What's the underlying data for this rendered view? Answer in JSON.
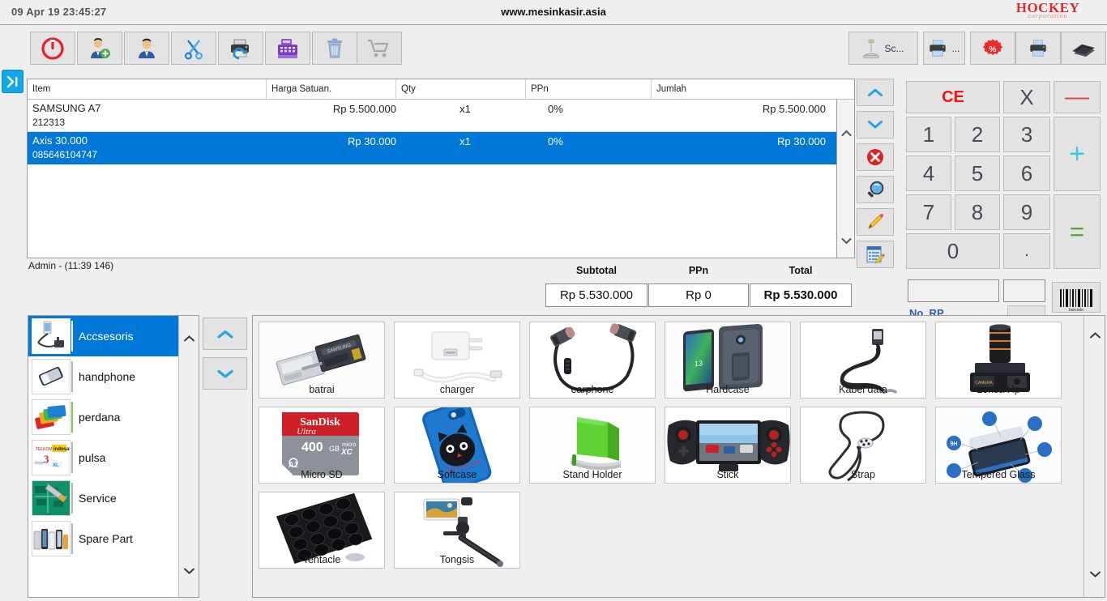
{
  "titlebar": {
    "datetime": "09 Apr 19  23:45:27",
    "site": "www.mesinkasir.asia",
    "logo_brand": "HOCKEY",
    "logo_sub": "corporation"
  },
  "toolbar_left": [
    {
      "name": "power-button",
      "icon": "power-icon",
      "label": ""
    },
    {
      "name": "add-customer-button",
      "icon": "user-add-icon",
      "label": ""
    },
    {
      "name": "customer-button",
      "icon": "user-icon",
      "label": ""
    },
    {
      "name": "cut-button",
      "icon": "scissors-icon",
      "label": ""
    },
    {
      "name": "reprint-button",
      "icon": "printer-refresh-icon",
      "label": ""
    },
    {
      "name": "cash-register-button",
      "icon": "cash-register-icon",
      "label": ""
    },
    {
      "name": "delete-button",
      "icon": "trash-icon",
      "label": ""
    },
    {
      "name": "cart-button",
      "icon": "cart-icon",
      "label": ""
    }
  ],
  "toolbar_right": [
    {
      "name": "scale-button",
      "icon": "scale-icon",
      "label": "Sc..."
    },
    {
      "name": "print-options-button",
      "icon": "printer-icon",
      "label": "..."
    },
    {
      "name": "discount-button",
      "icon": "discount-percent-icon",
      "label": ""
    },
    {
      "name": "print-button",
      "icon": "printer-icon",
      "label": ""
    },
    {
      "name": "card-button",
      "icon": "card-stack-icon",
      "label": ""
    }
  ],
  "cart": {
    "headers": [
      "Item",
      "Harga Satuan.",
      "Qty",
      "PPn",
      "Jumlah"
    ],
    "rows": [
      {
        "name": "SAMSUNG A7",
        "code": "212313",
        "price": "Rp 5.500.000",
        "qty": "x1",
        "ppn": "0%",
        "sum": "Rp 5.500.000",
        "selected": false
      },
      {
        "name": "Axis 30.000",
        "code": "085646104747",
        "price": "Rp 30.000",
        "qty": "x1",
        "ppn": "0%",
        "sum": "Rp 30.000",
        "selected": true
      }
    ]
  },
  "side_actions": [
    {
      "name": "move-up-button",
      "icon": "chevron-up-icon"
    },
    {
      "name": "move-down-button",
      "icon": "chevron-down-icon"
    },
    {
      "name": "remove-item-button",
      "icon": "delete-circle-icon"
    },
    {
      "name": "search-item-button",
      "icon": "magnifier-icon"
    },
    {
      "name": "edit-item-button",
      "icon": "pencil-icon"
    },
    {
      "name": "note-button",
      "icon": "notes-edit-icon"
    }
  ],
  "summary": {
    "status_user": "Admin - (11:39 146)",
    "subtotal_label": "Subtotal",
    "ppn_label": "PPn",
    "total_label": "Total",
    "subtotal_value": "Rp 5.530.000",
    "ppn_value": "Rp 0",
    "total_value": "Rp 5.530.000"
  },
  "numpad": {
    "ce": "CE",
    "x": "X",
    "minus": "—",
    "plus": "+",
    "equals": "=",
    "dot": ".",
    "digits": [
      "1",
      "2",
      "3",
      "4",
      "5",
      "6",
      "7",
      "8",
      "9",
      "0"
    ]
  },
  "payment": {
    "amount_value": "",
    "small_value": "",
    "barcode_icon": "barcode-icon",
    "clipped_label": "No. RP"
  },
  "categories": {
    "items": [
      {
        "label": "Accsesoris",
        "selected": true,
        "thumb": "accessory-mount"
      },
      {
        "label": "handphone",
        "selected": false,
        "thumb": "phone"
      },
      {
        "label": "perdana",
        "selected": false,
        "thumb": "sim-cards"
      },
      {
        "label": "pulsa",
        "selected": false,
        "thumb": "credit-logos"
      },
      {
        "label": "Service",
        "selected": false,
        "thumb": "circuit-board"
      },
      {
        "label": "Spare Part",
        "selected": false,
        "thumb": "parts"
      }
    ],
    "scroll_up_icon": "chevron-up-icon",
    "scroll_down_icon": "chevron-down-icon"
  },
  "product_nav": {
    "up_icon": "chevron-up-icon",
    "down_icon": "chevron-down-icon"
  },
  "products": [
    {
      "label": "batrai",
      "art": "battery"
    },
    {
      "label": "charger",
      "art": "charger"
    },
    {
      "label": "earphone",
      "art": "earphone"
    },
    {
      "label": "Hardcase",
      "art": "hardcase"
    },
    {
      "label": "Kabel data",
      "art": "cable"
    },
    {
      "label": "Lensa Hp",
      "art": "lens"
    },
    {
      "label": "Micro SD",
      "art": "microsd"
    },
    {
      "label": "Softcase",
      "art": "softcase"
    },
    {
      "label": "Stand Holder",
      "art": "standholder"
    },
    {
      "label": "Stick",
      "art": "gamepad"
    },
    {
      "label": "Strap",
      "art": "strap"
    },
    {
      "label": "Tempered Glass",
      "art": "temperedglass"
    },
    {
      "label": "Tentacle",
      "art": "tentacle"
    },
    {
      "label": "Tongsis",
      "art": "tongsis"
    }
  ],
  "colors": {
    "selection_blue": "#0078d7",
    "accent_cyan": "#0fa9e6",
    "brand_red": "#e02b2b",
    "panel_gray": "#efefef"
  }
}
